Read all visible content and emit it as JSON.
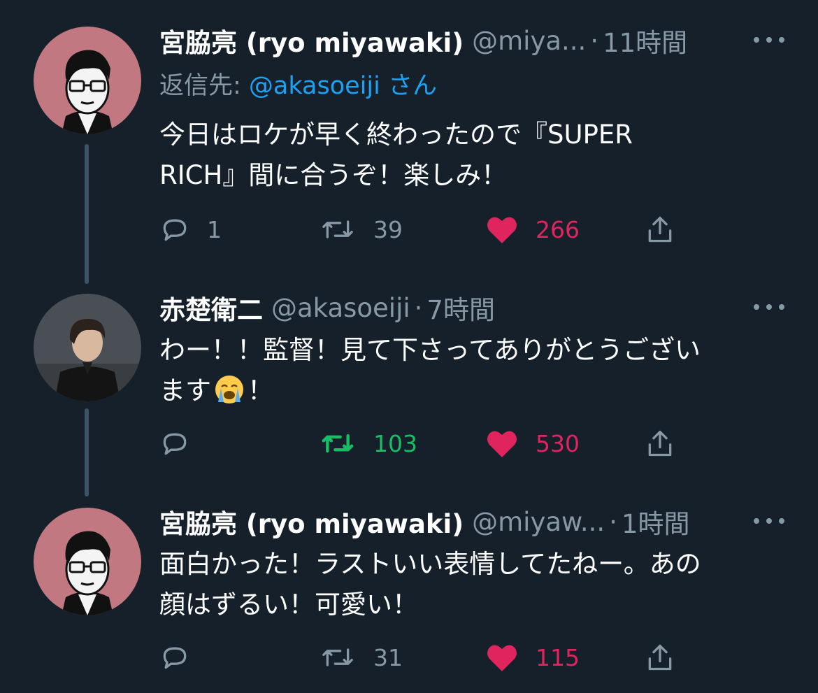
{
  "tweets": [
    {
      "display_name": "宮脇亮 (ryo miyawaki)",
      "handle": "@miya...",
      "dot": "·",
      "time": "11時間",
      "reply_to_prefix": "返信先: ",
      "reply_to_mention": "@akasoeiji",
      "reply_to_suffix": " さん",
      "text_lines": [
        "今日はロケが早く終わったので『SUPER",
        "RICH』間に合うぞ！楽しみ！"
      ],
      "replies": "1",
      "retweets": "39",
      "likes": "266",
      "avatar": "illustrated-man-with-glasses",
      "avatar_bg": "#c27880"
    },
    {
      "display_name": "赤楚衛二",
      "handle": "@akasoeiji",
      "dot": "·",
      "time": "7時間",
      "text_lines": [
        "わー！！監督！見て下さってありがとうござい",
        "ます",
        "！"
      ],
      "emoji": "loudly-crying-face",
      "replies": "",
      "retweets": "103",
      "retweet_active": true,
      "likes": "530",
      "avatar": "photo-young-man-in-black",
      "avatar_bg": "#4a4f55"
    },
    {
      "display_name": "宮脇亮 (ryo miyawaki)",
      "handle": "@miyaw...",
      "dot": "·",
      "time": "1時間",
      "text_lines": [
        "面白かった！ラストいい表情してたねー。あの",
        "顔はずるい！可愛い！"
      ],
      "replies": "",
      "retweets": "31",
      "likes": "115",
      "avatar": "illustrated-man-with-glasses",
      "avatar_bg": "#c27880"
    }
  ],
  "colors": {
    "background": "#15202b",
    "text": "#ffffff",
    "muted": "#8899a6",
    "link": "#1da1f2",
    "like": "#e0245e",
    "retweet_active": "#17bf63",
    "thread_line": "#3d5466"
  }
}
